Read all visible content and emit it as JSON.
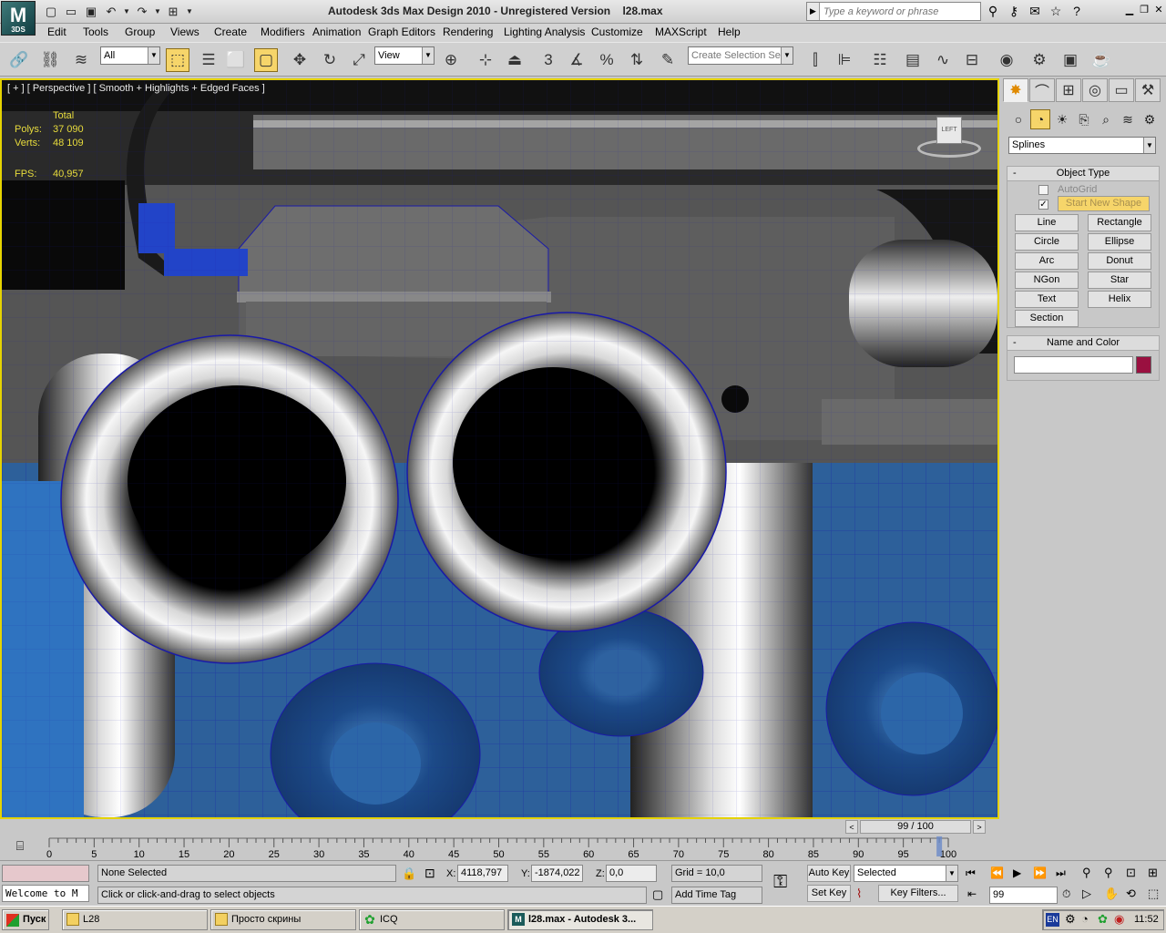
{
  "titlebar": {
    "logo": "M",
    "logo_sub": "3DS",
    "title": "Autodesk 3ds Max Design 2010 - Unregistered Version",
    "filename": "l28.max",
    "search_placeholder": "Type a keyword or phrase"
  },
  "menu": [
    "Edit",
    "Tools",
    "Group",
    "Views",
    "Create",
    "Modifiers",
    "Animation",
    "Graph Editors",
    "Rendering",
    "Lighting Analysis",
    "Customize",
    "MAXScript",
    "Help"
  ],
  "toolbar": {
    "filter_value": "All",
    "refcoord_value": "View",
    "selection_set_placeholder": "Create Selection Se"
  },
  "viewport": {
    "label": "[ + ] [ Perspective ] [ Smooth + Highlights + Edged Faces ]",
    "stats_header": "Total",
    "polys_label": "Polys:",
    "polys_value": "37 090",
    "verts_label": "Verts:",
    "verts_value": "48 109",
    "fps_label": "FPS:",
    "fps_value": "40,957",
    "viewcube_label": "LEFT"
  },
  "command_panel": {
    "dropdown_value": "Splines",
    "object_type_title": "Object Type",
    "autogrid_label": "AutoGrid",
    "start_new_shape_label": "Start New Shape",
    "buttons": [
      "Line",
      "Rectangle",
      "Circle",
      "Ellipse",
      "Arc",
      "Donut",
      "NGon",
      "Star",
      "Text",
      "Helix",
      "Section"
    ],
    "name_color_title": "Name and Color",
    "color_hex": "#9a1040"
  },
  "timeline": {
    "frame_display": "99 / 100",
    "ticks": [
      "0",
      "5",
      "10",
      "15",
      "20",
      "25",
      "30",
      "35",
      "40",
      "45",
      "50",
      "55",
      "60",
      "65",
      "70",
      "75",
      "80",
      "85",
      "90",
      "95",
      "100"
    ],
    "current_frame": 99,
    "total_frames": 100
  },
  "status": {
    "maxscript_text": "Welcome to M",
    "selection_status": "None Selected",
    "prompt": "Click or click-and-drag to select objects",
    "x_label": "X:",
    "x_value": "4118,797",
    "y_label": "Y:",
    "y_value": "-1874,022",
    "z_label": "Z:",
    "z_value": "0,0",
    "grid": "Grid = 10,0",
    "add_time_tag": "Add Time Tag",
    "auto_key": "Auto Key",
    "set_key": "Set Key",
    "selected_value": "Selected",
    "key_filters": "Key Filters...",
    "frame_value": "99"
  },
  "taskbar": {
    "start": "Пуск",
    "tasks": [
      "L28",
      "Просто скрины",
      "ICQ",
      "l28.max - Autodesk 3..."
    ],
    "lang": "EN",
    "clock": "11:52"
  }
}
